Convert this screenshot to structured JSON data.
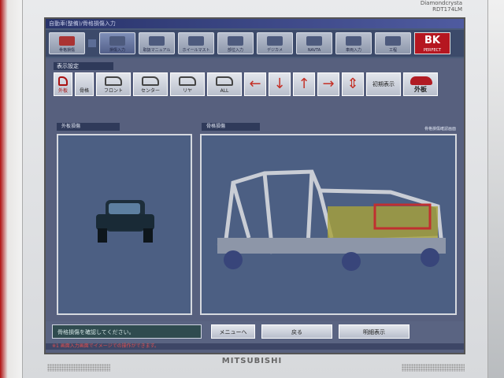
{
  "monitor": {
    "brand_top_line1": "Diamondcrysta",
    "brand_top_line2": "RDT174LM",
    "brand_bottom": "MITSUBISHI"
  },
  "app": {
    "title": "自動車(整備)/骨格損傷入力"
  },
  "toolbar": {
    "buttons": [
      {
        "label": "骨格損傷"
      },
      {
        "label": "損傷入力"
      },
      {
        "label": "取扱マニュアル"
      },
      {
        "label": "ホイールマスト"
      },
      {
        "label": "部位入力"
      },
      {
        "label": "デジカメ"
      },
      {
        "label": "NAVTA"
      },
      {
        "label": "車両入力"
      },
      {
        "label": "工程"
      }
    ],
    "bk_label": "BK",
    "bk_sub": "PERFECT"
  },
  "settings": {
    "label": "表示設定",
    "views": [
      {
        "label": "外板"
      },
      {
        "label": "骨格"
      },
      {
        "label": "フロント"
      },
      {
        "label": "センター"
      },
      {
        "label": "リヤ"
      },
      {
        "label": "ALL"
      }
    ],
    "arrows": [
      "←",
      "↓",
      "↑",
      "→",
      "⇕"
    ],
    "reset_label": "初期表示",
    "outer_label": "外板"
  },
  "left_panel": {
    "label": "外板損傷"
  },
  "right_panel": {
    "label": "骨格損傷",
    "note": "骨格損傷確認画面"
  },
  "bottom": {
    "message": "骨格損傷を確認してください。",
    "menu_btn": "メニューへ",
    "back_btn": "戻る",
    "detail_btn": "明細表示"
  },
  "status": "※1 画面入力画面でイメージでの操作ができます。"
}
